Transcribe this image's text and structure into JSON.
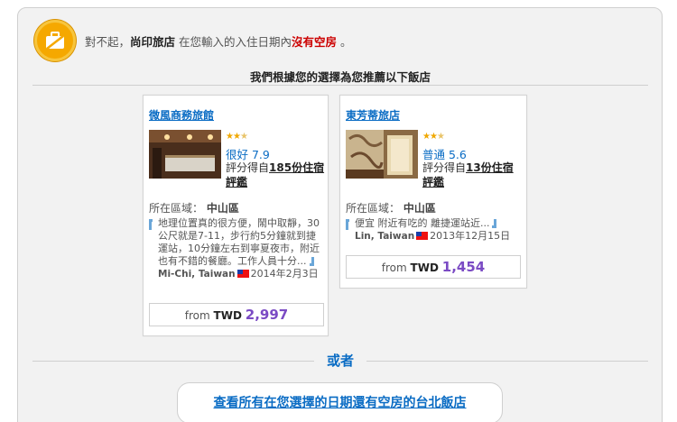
{
  "alert": {
    "prefix": "對不起，",
    "hotel_name": "尚印旅店",
    "middle": " 在您輸入的入住日期內",
    "status": "沒有空房",
    "suffix": " 。"
  },
  "recommend_title": "我們根據您的選擇為您推薦以下飯店",
  "hotels": [
    {
      "name": "微風商務旅館",
      "stars": 2.5,
      "rating_label": "很好 7.9",
      "reviews_prefix": "評分得自",
      "reviews_link": "185份住宿評鑑",
      "area_label": "所在區域：",
      "area_value": "中山區",
      "quote": "地理位置真的很方便，鬧中取靜，30公尺就是7-11，步行約5分鐘就到捷運站，10分鐘左右到寧夏夜市，附近也有不錯的餐廳。工作人員十分...",
      "reviewer": "Mi-Chi, Taiwan",
      "review_date": "2014年2月3日",
      "price_from": "from",
      "currency": "TWD",
      "price": "2,997"
    },
    {
      "name": "東芳蒂旅店",
      "stars": 2.5,
      "rating_label": "普通 5.6",
      "reviews_prefix": "評分得自",
      "reviews_link": "13份住宿評鑑",
      "area_label": "所在區域：",
      "area_value": "中山區",
      "quote": "便宜 附近有吃的 離捷運站近...",
      "reviewer": "Lin, Taiwan",
      "review_date": "2013年12月15日",
      "price_from": "from",
      "currency": "TWD",
      "price": "1,454"
    }
  ],
  "or_label": "或者",
  "cta_label": "查看所有在您選擇的日期還有空房的台北飯店",
  "colors": {
    "link": "#0a6cc4",
    "price": "#7b4bc4",
    "alert_red": "#cc0000",
    "star": "#f0a800"
  },
  "icons": {
    "alert": "suitcase-alert-icon",
    "star": "star-icon",
    "flag": "taiwan-flag-icon",
    "quote": "quote-mark-icon"
  }
}
